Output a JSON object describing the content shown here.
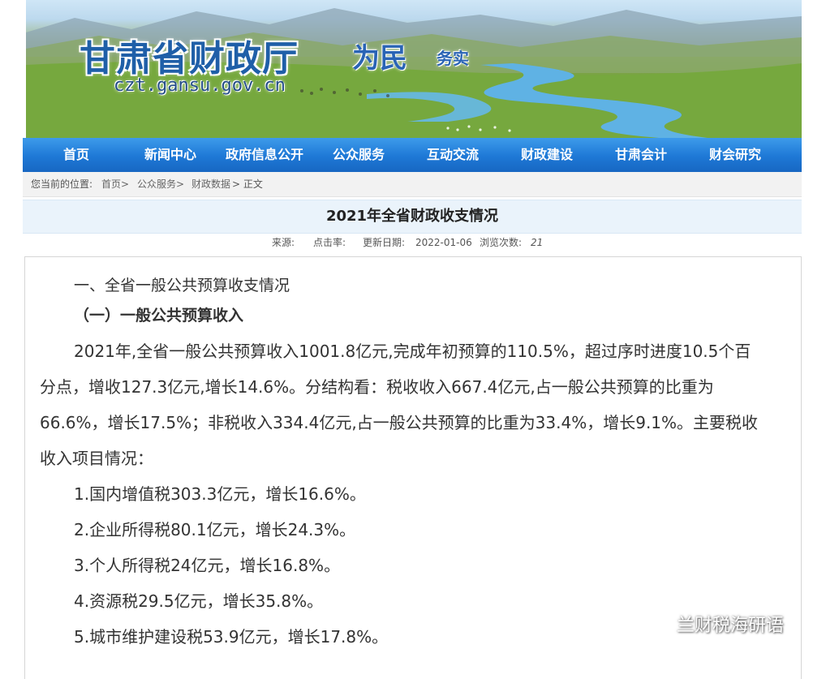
{
  "header": {
    "site_title": "甘肃省财政厅",
    "slogan_main": "为民",
    "slogan_sub": "务实",
    "domain": "czt.gansu.gov.cn"
  },
  "nav": {
    "items": [
      "首页",
      "新闻中心",
      "政府信息公开",
      "公众服务",
      "互动交流",
      "财政建设",
      "甘肃会计",
      "财会研究"
    ]
  },
  "breadcrumb": {
    "prefix": "您当前的位置:",
    "items": [
      "首页>",
      "公众服务>",
      "财政数据",
      "> 正文"
    ]
  },
  "article": {
    "title": "2021年全省财政收支情况",
    "meta": {
      "source_label": "来源:",
      "clicks_label": "点击率:",
      "date_label": "更新日期:",
      "date": "2022-01-06",
      "views_label": "浏览次数:",
      "views": "21"
    },
    "lines": [
      "一、全省一般公共预算收支情况",
      "（一）一般公共预算收入",
      "2021年,全省一般公共预算收入1001.8亿元,完成年初预算的110.5%，超过序时进度10.5个百",
      "分点，增收127.3亿元,增长14.6%。分结构看：税收收入667.4亿元,占一般公共预算的比重为",
      "66.6%，增长17.5%；非税收入334.4亿元,占一般公共预算的比重为33.4%，增长9.1%。主要税收",
      "收入项目情况：",
      "1.国内增值税303.3亿元，增长16.6%。",
      "2.企业所得税80.1亿元，增长24.3%。",
      "3.个人所得税24亿元，增长16.8%。",
      "4.资源税29.5亿元，增长35.8%。",
      "5.城市维护建设税53.9亿元，增长17.8%。"
    ]
  },
  "watermark": {
    "text": "兰财税海研语",
    "icon": "wechat-icon"
  },
  "colors": {
    "nav_bg": "#1e78d6",
    "title_bar_bg": "#eaf3fb",
    "site_title": "#1f5fa8"
  }
}
